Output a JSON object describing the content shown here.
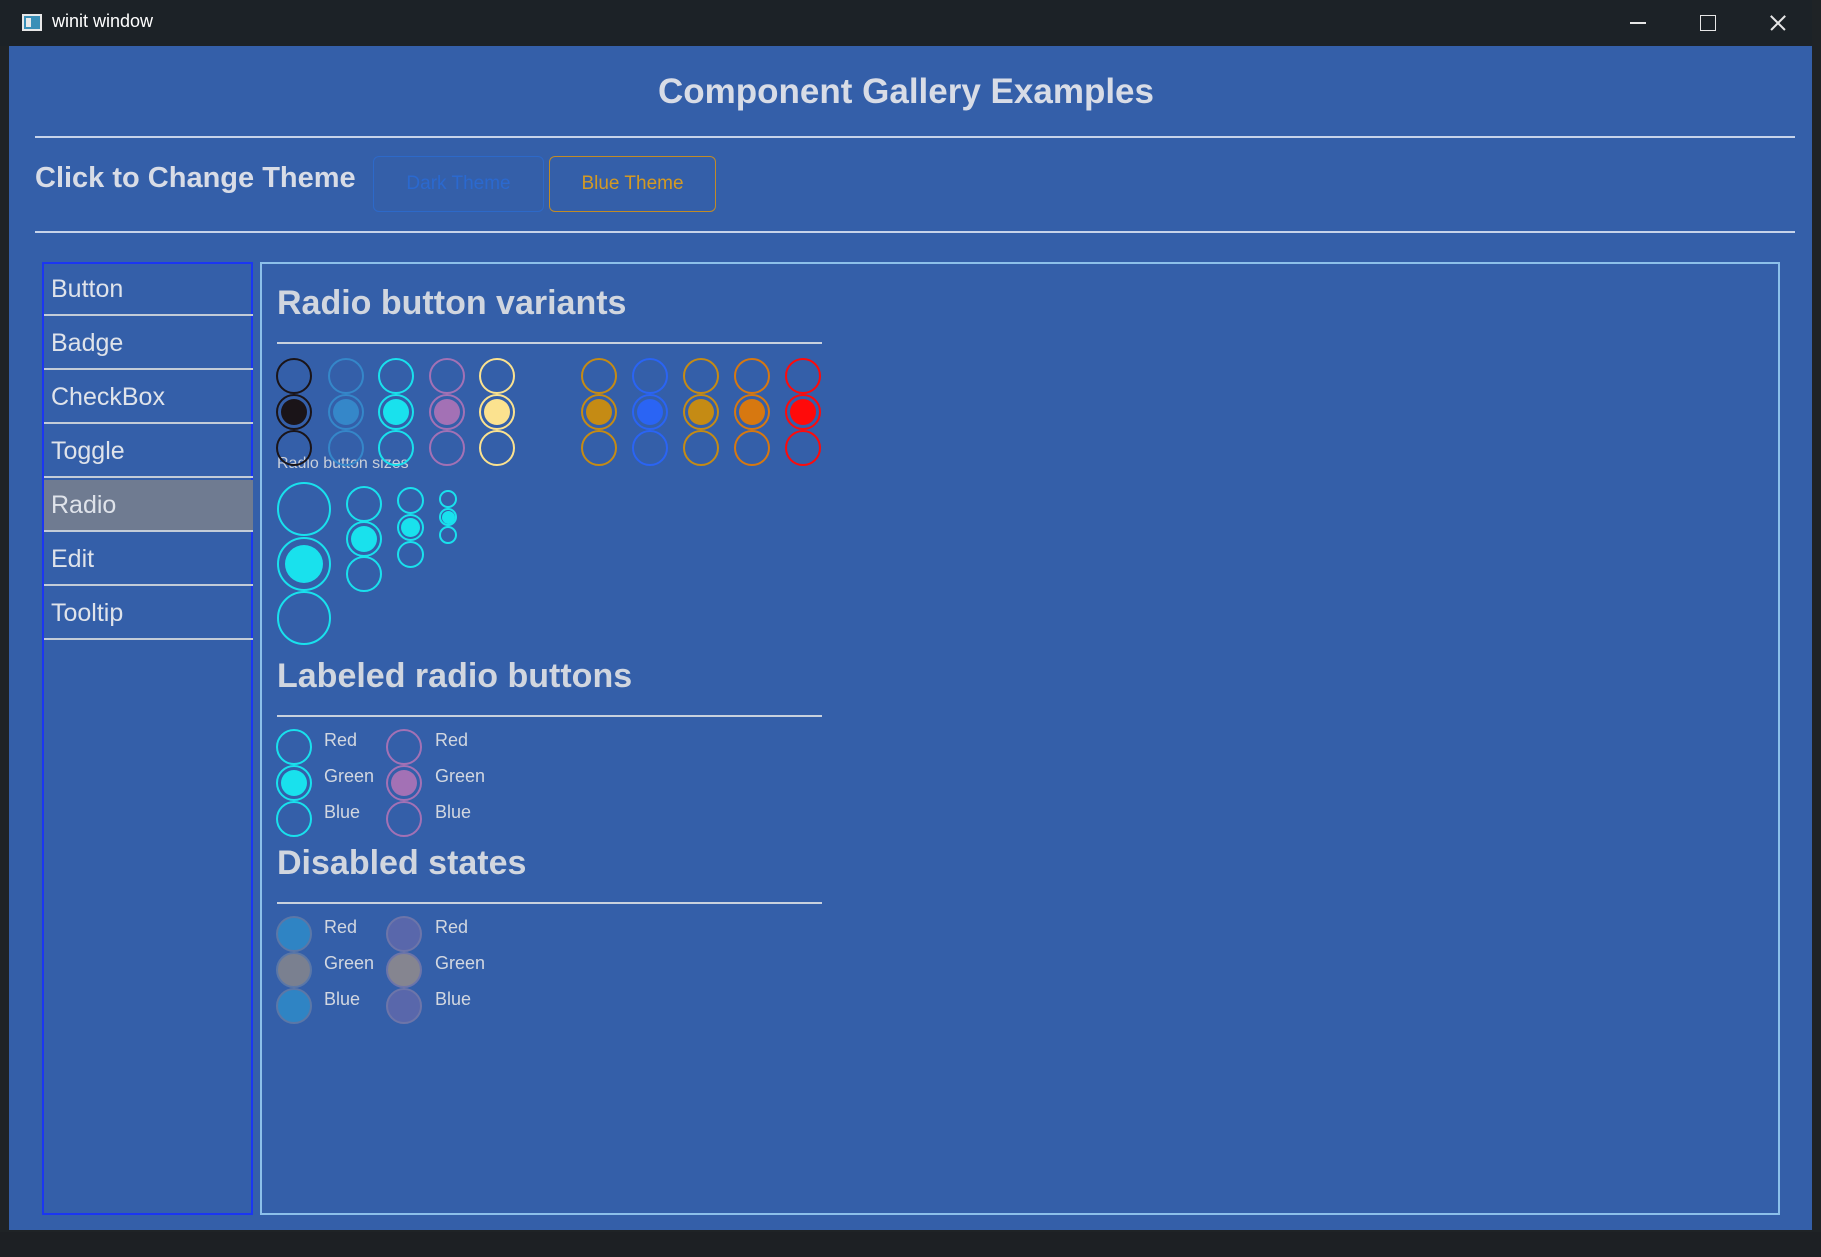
{
  "window": {
    "title": "winit window"
  },
  "page": {
    "heading": "Component Gallery Examples",
    "theme_label": "Click to Change Theme",
    "theme_buttons": [
      "Dark Theme",
      "Blue Theme"
    ]
  },
  "sidebar": {
    "items": [
      {
        "label": "Button",
        "active": false
      },
      {
        "label": "Badge",
        "active": false
      },
      {
        "label": "CheckBox",
        "active": false
      },
      {
        "label": "Toggle",
        "active": false
      },
      {
        "label": "Radio",
        "active": true
      },
      {
        "label": "Edit",
        "active": false
      },
      {
        "label": "Tooltip",
        "active": false
      }
    ]
  },
  "sections": {
    "variants_title": "Radio button variants",
    "sizes_label": "Radio button sizes",
    "labeled_title": "Labeled radio buttons",
    "disabled_title": "Disabled states"
  },
  "variant_colors": [
    "#1a1418",
    "#3587c9",
    "#19e1ed",
    "#a371b5",
    "#fbe28f",
    "#c58b14",
    "#2a64f4",
    "#c58b14",
    "#d77810",
    "#ff0a0a"
  ],
  "variant_selected_index": 1,
  "size_selected_index": 1,
  "size_color": "#19e1ed",
  "labeled_groups": [
    {
      "color": "#19e1ed",
      "options": [
        "Red",
        "Green",
        "Blue"
      ],
      "selected": 1
    },
    {
      "color": "#a371b5",
      "options": [
        "Red",
        "Green",
        "Blue"
      ],
      "selected": 1
    }
  ],
  "disabled_groups": [
    {
      "fill": "#2f84c4",
      "border": "#5b77a7",
      "selected_fill": "#7a8090",
      "options": [
        "Red",
        "Green",
        "Blue"
      ]
    },
    {
      "fill": "#5967ab",
      "border": "#6d75a9",
      "selected_fill": "#858590",
      "options": [
        "Red",
        "Green",
        "Blue"
      ]
    }
  ]
}
